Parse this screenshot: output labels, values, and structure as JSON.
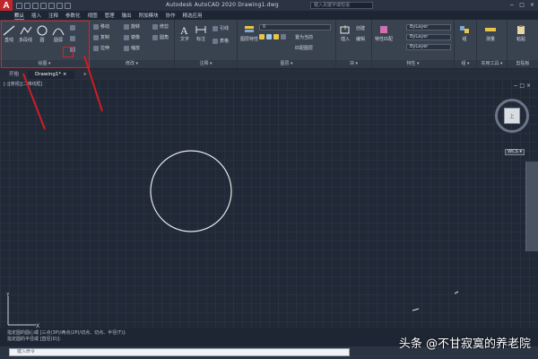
{
  "app": {
    "logo": "A",
    "title": "Autodesk AutoCAD 2020   Drawing1.dwg",
    "search_placeholder": "键入关键字或短语"
  },
  "menu": {
    "tabs": [
      {
        "label": "默认"
      },
      {
        "label": "插入"
      },
      {
        "label": "注释"
      },
      {
        "label": "参数化"
      },
      {
        "label": "视图"
      },
      {
        "label": "管理"
      },
      {
        "label": "输出"
      },
      {
        "label": "附加模块"
      },
      {
        "label": "协作"
      },
      {
        "label": "精选应用"
      }
    ]
  },
  "ribbon": {
    "draw": {
      "label": "绘图 ▾",
      "line": "直线",
      "polyline": "多段线",
      "circle": "圆",
      "arc": "圆弧"
    },
    "modify": {
      "label": "修改 ▾",
      "move": "移动",
      "rotate": "旋转",
      "copy": "复制",
      "mirror": "镜像",
      "stretch": "拉伸",
      "scale": "缩放",
      "trim": "修剪",
      "fillet": "圆角"
    },
    "annotation": {
      "label": "注释 ▾",
      "text": "文字",
      "dimension": "标注",
      "leader": "引线",
      "table": "表格"
    },
    "layers": {
      "label": "图层 ▾",
      "properties": "图层特性",
      "current": "置为当前",
      "match": "匹配图层",
      "layer_value": "0"
    },
    "block": {
      "label": "块 ▾",
      "insert": "插入",
      "create": "创建",
      "edit": "编辑"
    },
    "properties": {
      "label": "特性 ▾",
      "match": "特性匹配",
      "color": "ByLayer",
      "linetype": "ByLayer",
      "lineweight": "ByLayer"
    },
    "groups": {
      "label": "组 ▾",
      "group": "组"
    },
    "utilities": {
      "label": "实用工具 ▾",
      "measure": "测量"
    },
    "clipboard": {
      "label": "剪贴板",
      "paste": "粘贴"
    }
  },
  "doc_tabs": [
    {
      "label": "开始"
    },
    {
      "label": "Drawing1*  ×"
    },
    {
      "label": "+"
    }
  ],
  "viewport": {
    "label": "[-][俯视][二维线框]",
    "viewcube_face": "上",
    "viewcube_n": "北",
    "wcs": "WCS ▾",
    "window_controls": "−  □  ×"
  },
  "command": {
    "history": [
      "指定圆的圆心或 [三点(3P)/两点(2P)/切点、切点、半径(T)]:",
      "指定圆的半径或 [直径(D)]:"
    ],
    "input_placeholder": "键入命令"
  },
  "watermark": "头条 @不甘寂寞的养老院",
  "colors": {
    "highlight": "#e21f26",
    "canvas": "#212936",
    "ribbon": "#39424f",
    "logo": "#c0272d",
    "circle_stroke": "#e6e8ec"
  }
}
